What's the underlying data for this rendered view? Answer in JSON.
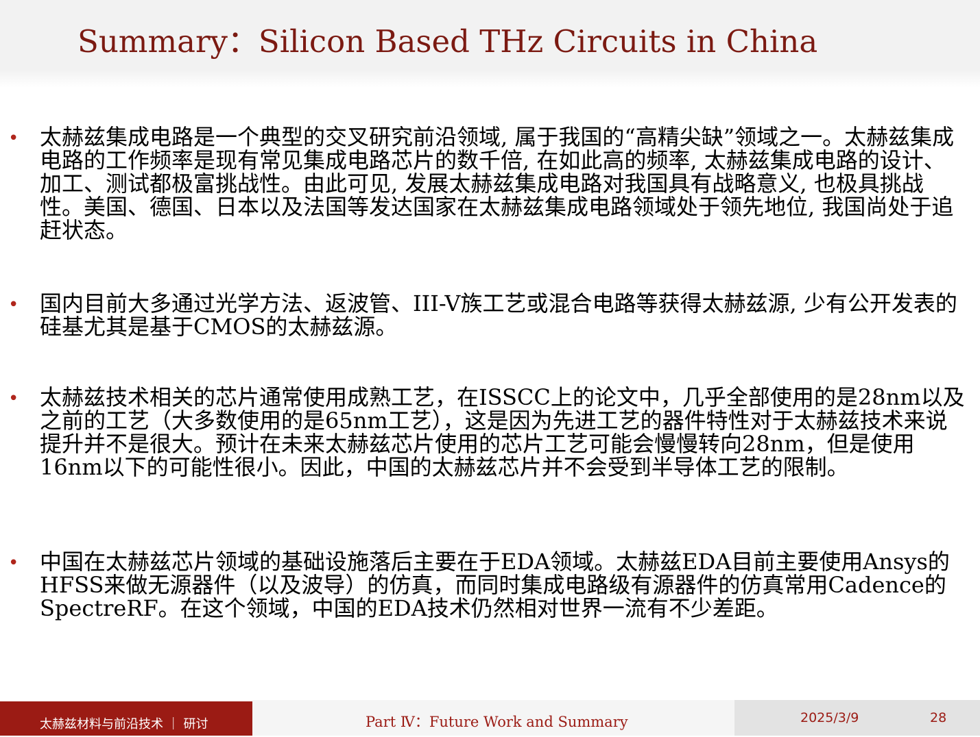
{
  "slide": {
    "title": "Summary：Silicon Based THz Circuits in China",
    "bullet_symbol": "•",
    "bullets": [
      {
        "text": "太赫兹集成电路是一个典型的交叉研究前沿领域, 属于我国的“高精尖缺”领域之一。太赫兹集成电路的工作频率是现有常见集成电路芯片的数千倍, 在如此高的频率, 太赫兹集成电路的设计、加工、测试都极富挑战性。由此可见, 发展太赫兹集成电路对我国具有战略意义, 也极具挑战性。美国、德国、日本以及法国等发达国家在太赫兹集成电路领域处于领先地位, 我国尚处于追赶状态。"
      },
      {
        "text": "国内目前大多通过光学方法、返波管、III-V族工艺或混合电路等获得太赫兹源, 少有公开发表的硅基尤其是基于CMOS的太赫兹源。"
      },
      {
        "text": "太赫兹技术相关的芯片通常使用成熟工艺，在ISSCC上的论文中，几乎全部使用的是28nm以及之前的工艺（大多数使用的是65nm工艺），这是因为先进工艺的器件特性对于太赫兹技术来说提升并不是很大。预计在未来太赫兹芯片使用的芯片工艺可能会慢慢转向28nm，但是使用16nm以下的可能性很小。因此，中国的太赫兹芯片并不会受到半导体工艺的限制。"
      },
      {
        "text": "中国在太赫兹芯片领域的基础设施落后主要在于EDA领域。太赫兹EDA目前主要使用Ansys的HFSS来做无源器件（以及波导）的仿真，而同时集成电路级有源器件的仿真常用Cadence的 SpectreRF。在这个领域，中国的EDA技术仍然相对世界一流有不少差距。"
      }
    ]
  },
  "footer": {
    "course": "太赫兹材料与前沿技术 ｜ 研讨",
    "section": "Part Ⅳ：Future Work and Summary",
    "date": "2025/3/9",
    "page": "28"
  },
  "colors": {
    "title": "#7b1a12",
    "bullet": "#b0261c",
    "footer_accent": "#9b1b14",
    "header_band": "#f2f2f2"
  }
}
